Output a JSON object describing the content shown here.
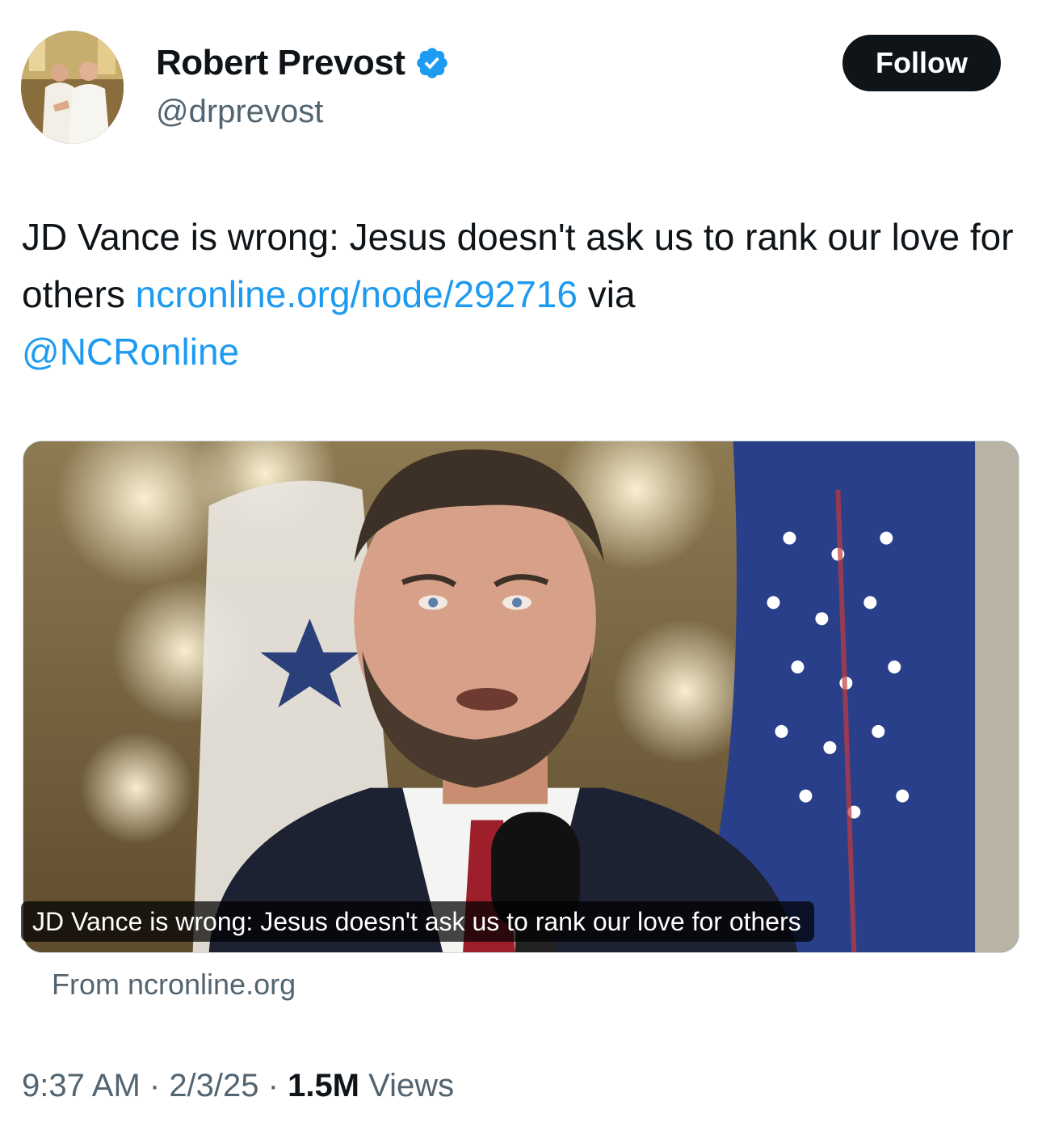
{
  "author": {
    "display_name": "Robert Prevost",
    "handle": "@drprevost",
    "verified": true,
    "avatar_icon": "avatar-photo"
  },
  "follow_label": "Follow",
  "tweet": {
    "text_part1": "JD Vance is wrong: Jesus doesn't ask us to rank our love for others ",
    "link_url_text": "ncronline.org/node/292716",
    "text_part2": " via ",
    "mention": "@NCRonline"
  },
  "card": {
    "title": "JD Vance is wrong: Jesus doesn't ask us to rank our love for others",
    "source": "From ncronline.org"
  },
  "meta": {
    "time": "9:37 AM",
    "sep1": " · ",
    "date": "2/3/25",
    "sep2": " · ",
    "views_count": "1.5M",
    "views_label": " Views"
  },
  "colors": {
    "link": "#1d9bf0",
    "text": "#0f1419",
    "secondary": "#536471",
    "follow_bg": "#0f1419",
    "verified": "#1d9bf0"
  }
}
